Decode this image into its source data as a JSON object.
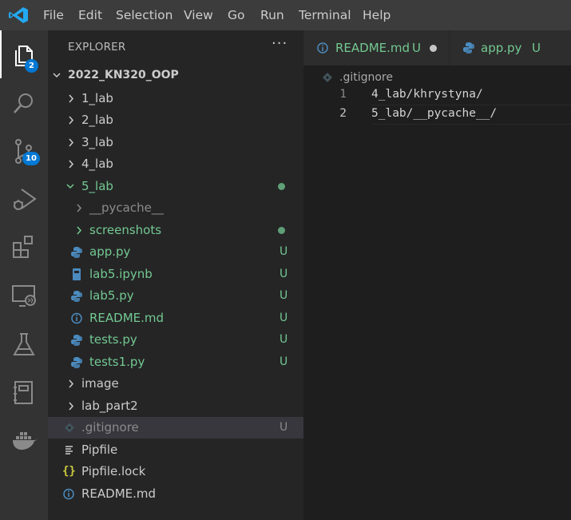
{
  "menu": [
    "File",
    "Edit",
    "Selection",
    "View",
    "Go",
    "Run",
    "Terminal",
    "Help"
  ],
  "activity_bar": {
    "explorer_badge": "2",
    "scm_badge": "10",
    "items": [
      "files-icon",
      "search-icon",
      "source-control-icon",
      "run-debug-icon",
      "extensions-icon",
      "remote-explorer-icon",
      "testing-icon",
      "notebook-icon",
      "docker-icon"
    ]
  },
  "explorer": {
    "title": "EXPLORER",
    "more": "···",
    "root": "2022_KN320_OOP",
    "tree": [
      {
        "label": "1_lab",
        "type": "folder",
        "expanded": false
      },
      {
        "label": "2_lab",
        "type": "folder",
        "expanded": false
      },
      {
        "label": "3_lab",
        "type": "folder",
        "expanded": false
      },
      {
        "label": "4_lab",
        "type": "folder",
        "expanded": false
      },
      {
        "label": "5_lab",
        "type": "folder",
        "expanded": true,
        "modified": true
      },
      {
        "label": "__pycache__",
        "type": "folder",
        "expanded": false
      },
      {
        "label": "screenshots",
        "type": "folder",
        "expanded": false,
        "modified": true
      },
      {
        "label": "app.py",
        "type": "python",
        "status": "U"
      },
      {
        "label": "lab5.ipynb",
        "type": "notebook",
        "status": "U"
      },
      {
        "label": "lab5.py",
        "type": "python",
        "status": "U"
      },
      {
        "label": "README.md",
        "type": "info",
        "status": "U"
      },
      {
        "label": "tests.py",
        "type": "python",
        "status": "U"
      },
      {
        "label": "tests1.py",
        "type": "python",
        "status": "U"
      },
      {
        "label": "image",
        "type": "folder",
        "expanded": false
      },
      {
        "label": "lab_part2",
        "type": "folder",
        "expanded": false
      },
      {
        "label": ".gitignore",
        "type": "git",
        "status": "U",
        "selected": true
      },
      {
        "label": "Pipfile",
        "type": "lines"
      },
      {
        "label": "Pipfile.lock",
        "type": "json"
      },
      {
        "label": "README.md",
        "type": "info"
      }
    ]
  },
  "tabs": [
    {
      "label": "README.md",
      "status": "U",
      "dirty": true
    },
    {
      "label": "app.py",
      "status": "U"
    }
  ],
  "editor": {
    "breadcrumb": ".gitignore",
    "lines": [
      {
        "number": "1",
        "text": "4_lab/khrystyna/"
      },
      {
        "number": "2",
        "text": "5_lab/__pycache__/"
      }
    ]
  },
  "colors": {
    "untracked": "#73c991",
    "ignored": "#8b8b8b",
    "accent": "#0078d4",
    "python_icon": "#4b8bbe",
    "json_icon": "#cbcb41"
  }
}
